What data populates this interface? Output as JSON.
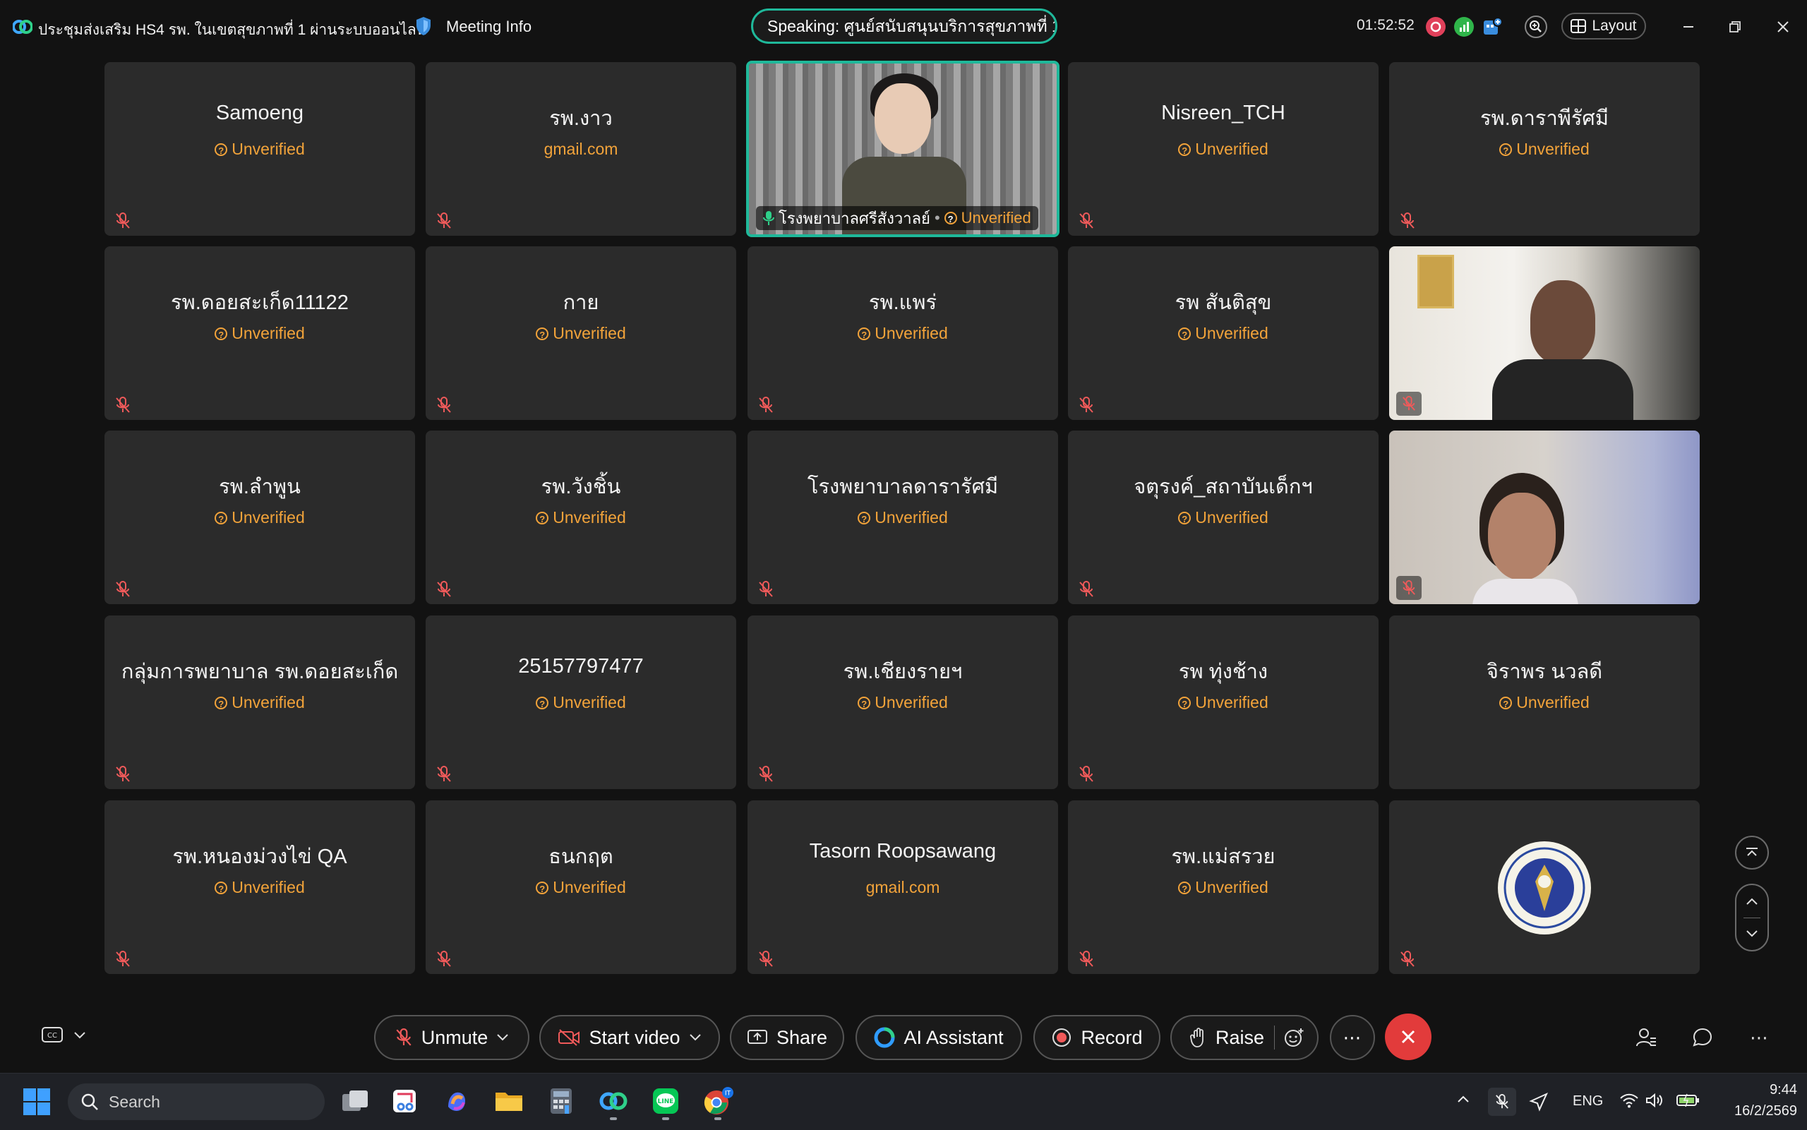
{
  "titlebar": {
    "meeting_title": "ประชุมส่งเสริม HS4 รพ. ในเขตสุขภาพที่ 1 ผ่านระบบออนไลน์",
    "meeting_info_label": "Meeting Info",
    "speaking": "Speaking: ศูนย์สนับสนุนบริการสุขภาพที่ 1",
    "timer": "01:52:52",
    "layout_label": "Layout"
  },
  "participants": [
    {
      "name": "Samoeng",
      "status": "Unverified"
    },
    {
      "name": "รพ.งาว",
      "status": "gmail.com"
    },
    {
      "name": "โรงพยาบาลศรีสังวาลย์",
      "status": "Unverified"
    },
    {
      "name": "Nisreen_TCH",
      "status": "Unverified"
    },
    {
      "name": "รพ.ดาราพีรัศมี",
      "status": "Unverified"
    },
    {
      "name": "รพ.ดอยสะเก็ด11122",
      "status": "Unverified"
    },
    {
      "name": "กาย",
      "status": "Unverified"
    },
    {
      "name": "รพ.แพร่",
      "status": "Unverified"
    },
    {
      "name": "รพ สันติสุข",
      "status": "Unverified"
    },
    {
      "name": "รพ.ลำพูน",
      "status": "Unverified"
    },
    {
      "name": "รพ.วังชิ้น",
      "status": "Unverified"
    },
    {
      "name": "โรงพยาบาลดารารัศมี",
      "status": "Unverified"
    },
    {
      "name": "จตุรงค์_สถาบันเด็กฯ",
      "status": "Unverified"
    },
    {
      "name": "กลุ่มการพยาบาล รพ.ดอยสะเก็ด",
      "status": "Unverified"
    },
    {
      "name": "25157797477",
      "status": "Unverified"
    },
    {
      "name": "รพ.เชียงรายฯ",
      "status": "Unverified"
    },
    {
      "name": "รพ ทุ่งช้าง",
      "status": "Unverified"
    },
    {
      "name": "จิราพร นวลดี",
      "status": "Unverified"
    },
    {
      "name": "รพ.หนองม่วงไข่ QA",
      "status": "Unverified"
    },
    {
      "name": "ธนกฤต",
      "status": "Unverified"
    },
    {
      "name": "Tasorn Roopsawang",
      "status": "gmail.com"
    },
    {
      "name": "รพ.แม่สรวย",
      "status": "Unverified"
    }
  ],
  "controls": {
    "unmute": "Unmute",
    "start_video": "Start video",
    "share": "Share",
    "ai_assistant": "AI Assistant",
    "record": "Record",
    "raise": "Raise"
  },
  "taskbar": {
    "search_placeholder": "Search",
    "language": "ENG",
    "time": "9:44",
    "date": "16/2/2569"
  },
  "colors": {
    "accent_teal": "#1fb89a",
    "unverified_orange": "#f2a33a",
    "end_call_red": "#e23b3b",
    "tile_bg": "#2b2b2b"
  }
}
